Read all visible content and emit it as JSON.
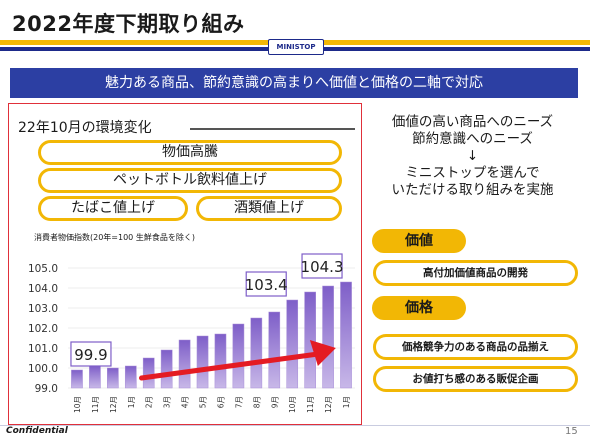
{
  "header": {
    "title": "2022年度下期取り組み",
    "logo_text": "MINISTOP"
  },
  "banner": {
    "text": "魅力ある商品、節約意識の高まりへ価値と価格の二軸で対応"
  },
  "left": {
    "heading": "22年10月の環境変化",
    "pills": [
      "物価高騰",
      "ペットボトル飲料値上げ",
      "たばこ値上げ",
      "酒類値上げ"
    ]
  },
  "chart_data": {
    "type": "bar",
    "title": "消費者物価指数(20年=100 生鮮食品を除く)",
    "categories": [
      "10月",
      "11月",
      "12月",
      "1月",
      "2月",
      "3月",
      "4月",
      "5月",
      "6月",
      "7月",
      "8月",
      "9月",
      "10月",
      "11月",
      "12月",
      "1月"
    ],
    "values": [
      99.9,
      100.1,
      100.0,
      100.1,
      100.5,
      100.9,
      101.4,
      101.6,
      101.7,
      102.2,
      102.5,
      102.8,
      103.4,
      103.8,
      104.1,
      104.3
    ],
    "ylim": [
      99.0,
      105.0
    ],
    "yticks": [
      "99.0",
      "100.0",
      "101.0",
      "102.0",
      "103.0",
      "104.0",
      "105.0"
    ],
    "annotations": [
      "99.9",
      "103.4",
      "104.3"
    ],
    "bar_color": "#c8b8e8",
    "bar_color_top": "#7e5ec8",
    "arrow_color": "#e41b23"
  },
  "right": {
    "lines": [
      "価値の高い商品へのニーズ",
      "節約意識へのニーズ",
      "↓",
      "ミニストップを選んで",
      "いただける取り組みを実施"
    ],
    "tag_value": "価値",
    "value_item": "高付加価値商品の開発",
    "tag_price": "価格",
    "price_items": [
      "価格競争力のある商品の品揃え",
      "お値打ち感のある販促企画"
    ]
  },
  "footer": {
    "confidential": "Confidential",
    "page": "15"
  },
  "colors": {
    "accent_yellow": "#f2b705",
    "brand_blue": "#1d2a8a",
    "banner_blue": "#2c3fa3",
    "panel_border": "#e0303a"
  }
}
